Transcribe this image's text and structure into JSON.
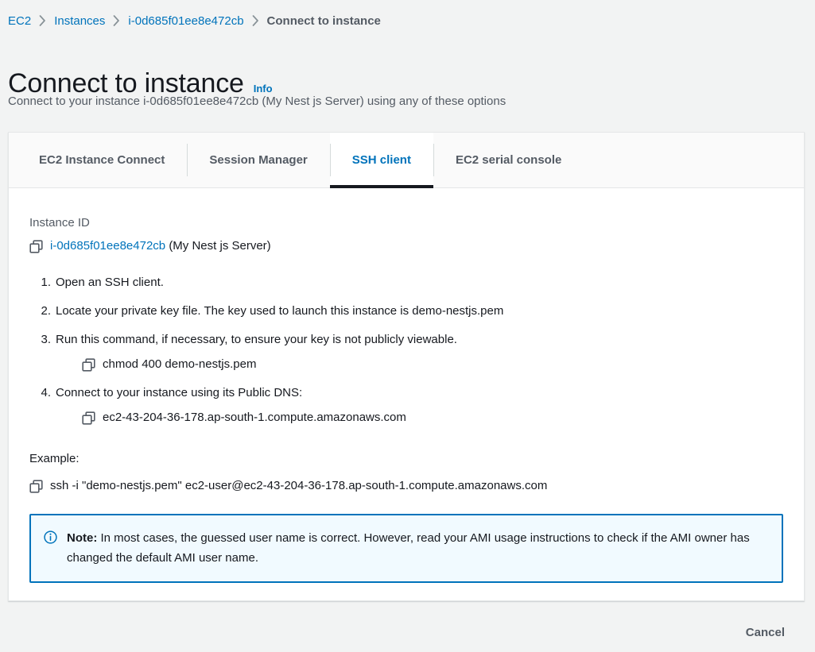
{
  "breadcrumb": {
    "items": [
      {
        "label": "EC2",
        "current": false
      },
      {
        "label": "Instances",
        "current": false
      },
      {
        "label": "i-0d685f01ee8e472cb",
        "current": false
      },
      {
        "label": "Connect to instance",
        "current": true
      }
    ]
  },
  "header": {
    "title": "Connect to instance",
    "info_label": "Info",
    "subtitle": "Connect to your instance i-0d685f01ee8e472cb (My Nest js Server) using any of these options"
  },
  "tabs": [
    {
      "label": "EC2 Instance Connect",
      "active": false
    },
    {
      "label": "Session Manager",
      "active": false
    },
    {
      "label": "SSH client",
      "active": true
    },
    {
      "label": "EC2 serial console",
      "active": false
    }
  ],
  "instance": {
    "field_label": "Instance ID",
    "id": "i-0d685f01ee8e472cb",
    "name_suffix": "(My Nest js Server)"
  },
  "steps": [
    {
      "num": "1.",
      "text": "Open an SSH client.",
      "sub": null
    },
    {
      "num": "2.",
      "text": "Locate your private key file. The key used to launch this instance is demo-nestjs.pem",
      "sub": null
    },
    {
      "num": "3.",
      "text": "Run this command, if necessary, to ensure your key is not publicly viewable.",
      "sub": "chmod 400 demo-nestjs.pem"
    },
    {
      "num": "4.",
      "text": "Connect to your instance using its Public DNS:",
      "sub": "ec2-43-204-36-178.ap-south-1.compute.amazonaws.com"
    }
  ],
  "example": {
    "label": "Example:",
    "command": "ssh -i \"demo-nestjs.pem\" ec2-user@ec2-43-204-36-178.ap-south-1.compute.amazonaws.com"
  },
  "note": {
    "prefix": "Note:",
    "text": " In most cases, the guessed user name is correct. However, read your AMI usage instructions to check if the AMI owner has changed the default AMI user name."
  },
  "footer": {
    "cancel_label": "Cancel"
  },
  "colors": {
    "link": "#0073bb",
    "text": "#16191f",
    "muted": "#545b64",
    "page_bg": "#f2f3f3",
    "card_bg": "#ffffff",
    "alert_bg": "#f1faff",
    "alert_border": "#0073bb",
    "active_tab_underline": "#16191f"
  }
}
